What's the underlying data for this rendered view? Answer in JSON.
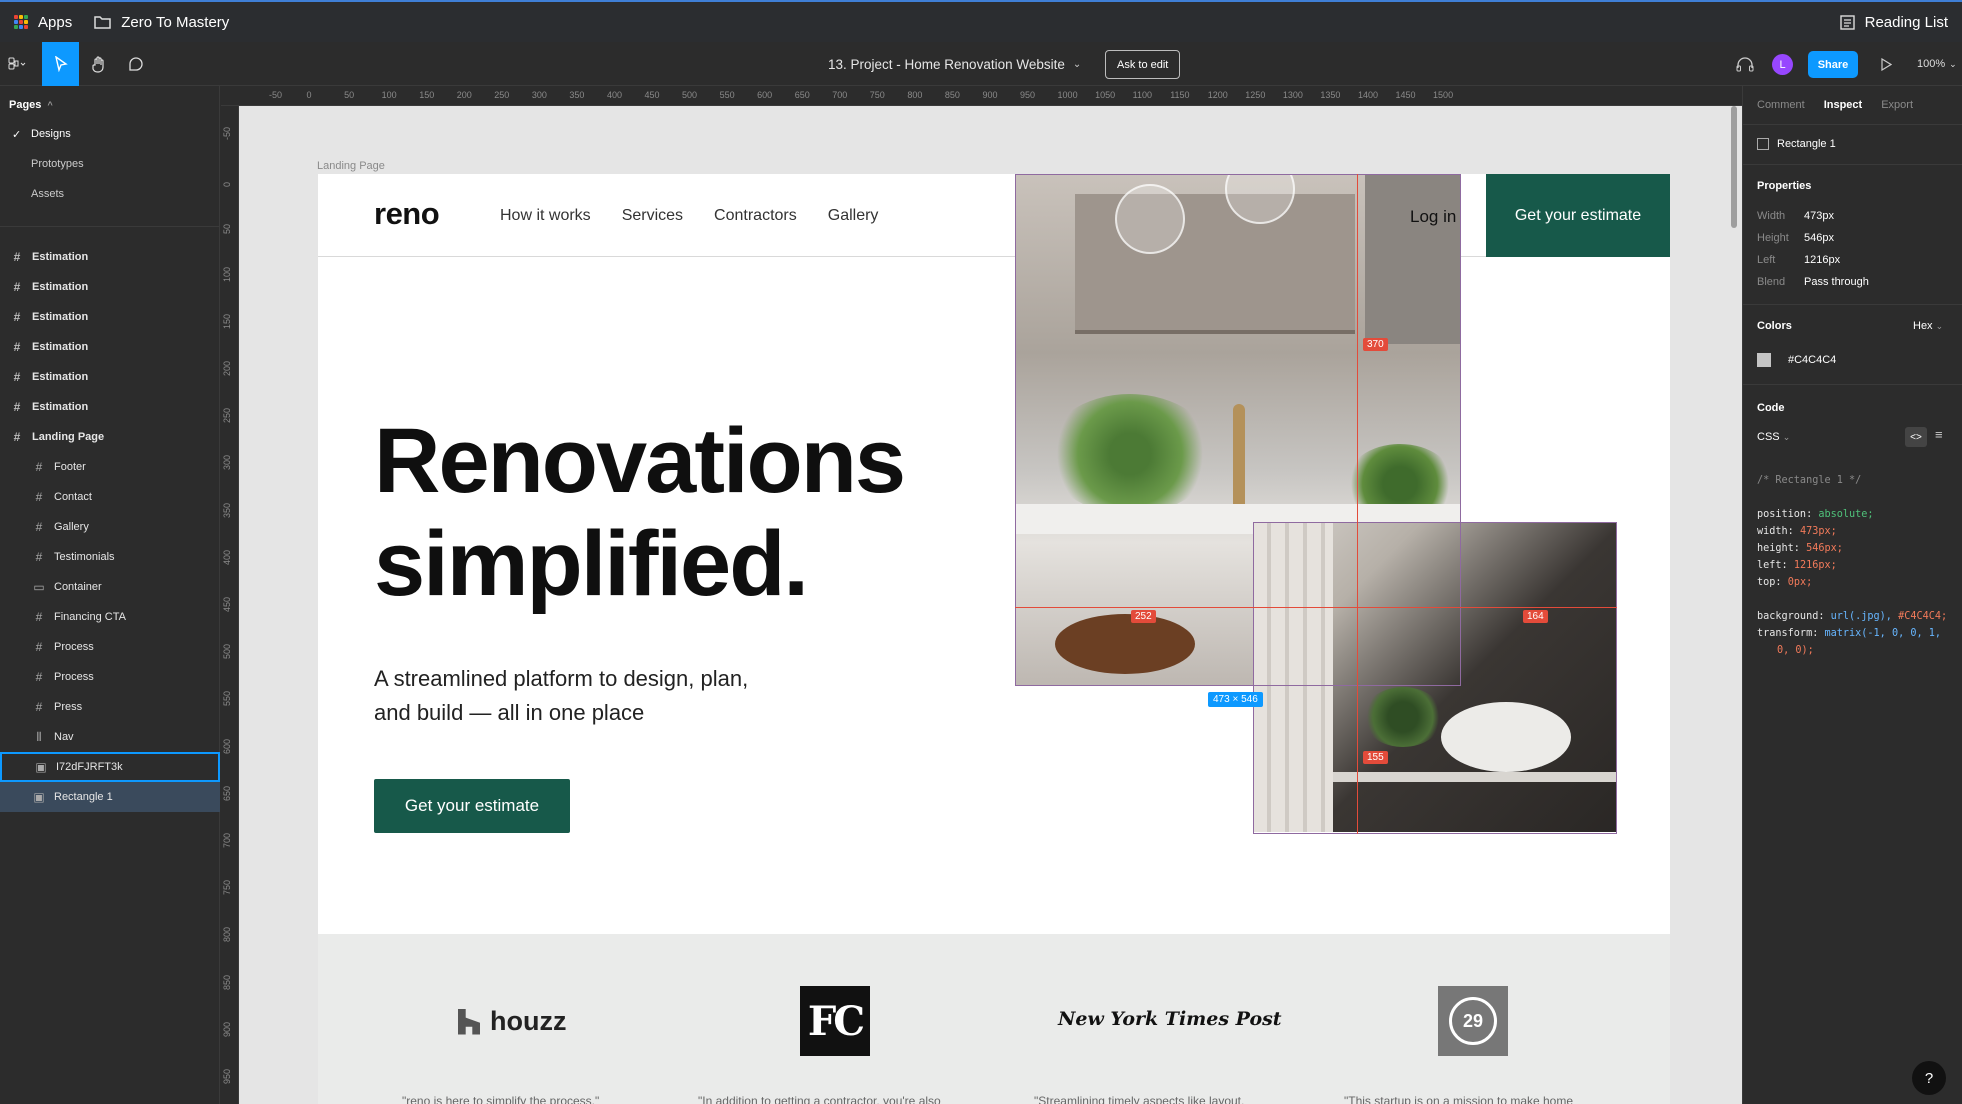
{
  "browser": {
    "apps_label": "Apps",
    "folder_label": "Zero To Mastery",
    "reading_list_label": "Reading List"
  },
  "toolbar": {
    "file_title": "13. Project - Home Renovation Website",
    "ask_to_edit": "Ask to edit",
    "share": "Share",
    "avatar_initial": "L",
    "zoom": "100%"
  },
  "left_panel": {
    "pages_header": "Pages",
    "pages": [
      "Designs",
      "Prototypes",
      "Assets"
    ],
    "current_page": "Designs",
    "layers": [
      {
        "name": "Estimation",
        "level": "top"
      },
      {
        "name": "Estimation",
        "level": "top"
      },
      {
        "name": "Estimation",
        "level": "top"
      },
      {
        "name": "Estimation",
        "level": "top"
      },
      {
        "name": "Estimation",
        "level": "top"
      },
      {
        "name": "Estimation",
        "level": "top"
      },
      {
        "name": "Landing Page",
        "level": "top"
      },
      {
        "name": "Footer",
        "level": "child"
      },
      {
        "name": "Contact",
        "level": "child"
      },
      {
        "name": "Gallery",
        "level": "child"
      },
      {
        "name": "Testimonials",
        "level": "child"
      },
      {
        "name": "Container",
        "level": "child"
      },
      {
        "name": "Financing CTA",
        "level": "child"
      },
      {
        "name": "Process",
        "level": "child"
      },
      {
        "name": "Process",
        "level": "child"
      },
      {
        "name": "Press",
        "level": "child"
      },
      {
        "name": "Nav",
        "level": "child"
      },
      {
        "name": "I72dFJRFT3k",
        "level": "child"
      },
      {
        "name": "Rectangle 1",
        "level": "child"
      }
    ]
  },
  "canvas": {
    "ruler_h": [
      "-50",
      "0",
      "50",
      "100",
      "150",
      "200",
      "250",
      "300",
      "350",
      "400",
      "450",
      "500",
      "550",
      "600",
      "650",
      "700",
      "750",
      "800",
      "850",
      "900",
      "950",
      "1000",
      "1050",
      "1100",
      "1150",
      "1200",
      "1250",
      "1300",
      "1350",
      "1400",
      "1450",
      "1500"
    ],
    "ruler_v": [
      "-50",
      "0",
      "50",
      "100",
      "150",
      "200",
      "250",
      "300",
      "350",
      "400",
      "450",
      "500",
      "550",
      "600",
      "650",
      "700",
      "750",
      "800",
      "850",
      "900",
      "950"
    ],
    "frame_label": "Landing Page",
    "site": {
      "logo": "reno",
      "nav_links": [
        "How it works",
        "Services",
        "Contractors",
        "Gallery"
      ],
      "login": "Log in",
      "cta_top": "Get your estimate",
      "hero_title_line1": "Renovations",
      "hero_title_line2": "simplified.",
      "hero_sub_line1": "A streamlined platform to design, plan,",
      "hero_sub_line2": "and build — all in one place",
      "cta_hero": "Get your estimate",
      "press": {
        "logos": [
          "houzz",
          "FC",
          "New York Times Post",
          "29"
        ],
        "quotes": [
          "\"reno is here to simplify the process.\"",
          "\"In addition to getting a contractor, you're also",
          "\"Streamlining timely aspects like layout,",
          "\"This startup is on a mission to make home"
        ]
      }
    },
    "measure": {
      "badge_370": "370",
      "badge_252": "252",
      "badge_164": "164",
      "badge_155": "155",
      "dimensions": "473 × 546"
    }
  },
  "right_panel": {
    "tabs": [
      "Comment",
      "Inspect",
      "Export"
    ],
    "active_tab": "Inspect",
    "layer_name": "Rectangle 1",
    "properties_header": "Properties",
    "properties": [
      {
        "k": "Width",
        "v": "473px"
      },
      {
        "k": "Height",
        "v": "546px"
      },
      {
        "k": "Left",
        "v": "1216px"
      },
      {
        "k": "Blend",
        "v": "Pass through"
      }
    ],
    "colors_header": "Colors",
    "color_format": "Hex",
    "color_value": "#C4C4C4",
    "code_header": "Code",
    "code_lang": "CSS",
    "code_comment": "/* Rectangle 1 */",
    "code_lines": [
      {
        "prop": "position:",
        "val": "absolute",
        "cls": "kw"
      },
      {
        "prop": "width:",
        "val": "473px",
        "cls": "num"
      },
      {
        "prop": "height:",
        "val": "546px",
        "cls": "num"
      },
      {
        "prop": "left:",
        "val": "1216px",
        "cls": "num"
      },
      {
        "prop": "top:",
        "val": "0px",
        "cls": "num"
      }
    ],
    "code_bg_prop": "background:",
    "code_bg_fn": "url(.jpg),",
    "code_bg_color": "#C4C4C4;",
    "code_tf_prop": "transform:",
    "code_tf_val": "matrix(-1, 0, 0, 1,",
    "code_tf_val2": "0, 0);"
  },
  "help_label": "?",
  "colors": {
    "accent": "#0d99ff",
    "brand_green": "#17594a",
    "measure_red": "#e34b3a",
    "selection_purple": "#8f6aa0"
  }
}
